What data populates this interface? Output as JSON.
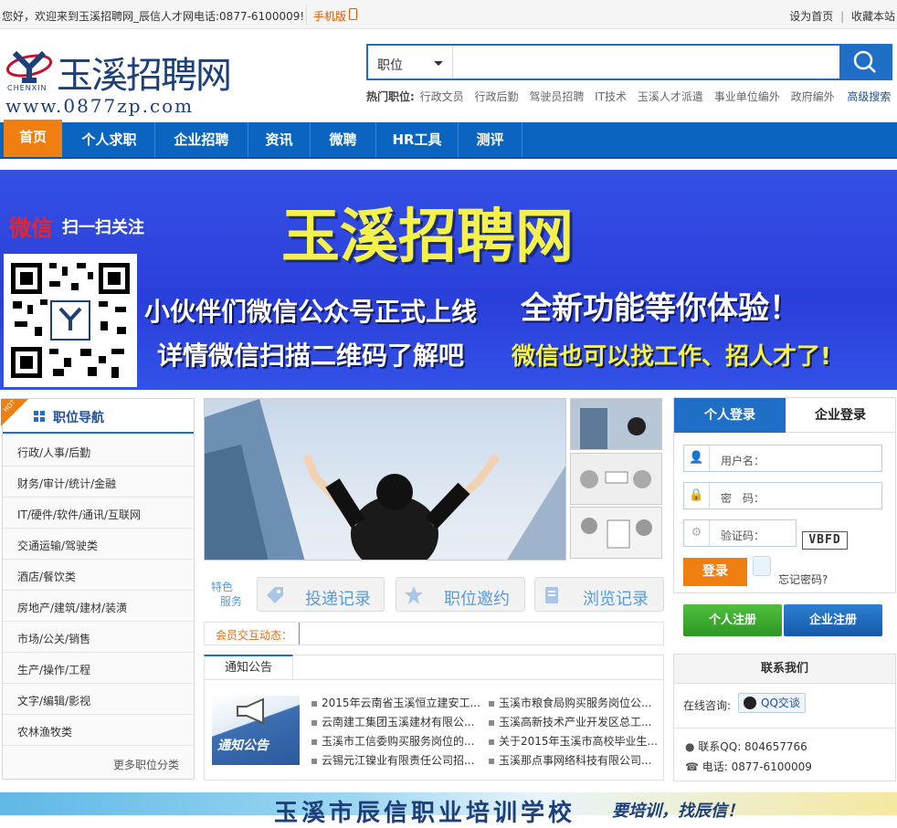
{
  "topbar": {
    "welcome": "您好，欢迎来到玉溪招聘网_辰信人才网电话:0877-6100009!",
    "mobile": "手机版",
    "set_home": "设为首页",
    "divider": "|",
    "bookmark": "收藏本站"
  },
  "logo": {
    "brand_cn": "玉溪招聘网",
    "brand_en": "CHENXIN",
    "url": "www.0877zp.com"
  },
  "search": {
    "type_selected": "职位",
    "query": "",
    "hot_label": "热门职位:",
    "hot_keywords": [
      "行政文员",
      "行政后勤",
      "驾驶员招聘",
      "IT技术",
      "玉溪人才派遣",
      "事业单位编外",
      "政府编外"
    ],
    "advanced": "高级搜索"
  },
  "nav": {
    "items": [
      "首页",
      "个人求职",
      "企业招聘",
      "资讯",
      "微聘",
      "HR工具",
      "测评"
    ]
  },
  "banner": {
    "wechat": "微信",
    "scan": "扫一扫关注",
    "title": "玉溪招聘网",
    "line1": "小伙伴们微信公众号正式上线",
    "line2": "详情微信扫描二维码了解吧",
    "line3": "全新功能等你体验！",
    "line4": "微信也可以找工作、招人才了!"
  },
  "jobnav": {
    "hot_badge": "HOT",
    "title": "职位导航",
    "items": [
      "行政/人事/后勤",
      "财务/审计/统计/金融",
      "IT/硬件/软件/通讯/互联网",
      "交通运输/驾驶类",
      "酒店/餐饮类",
      "房地产/建筑/建材/装潢",
      "市场/公关/销售",
      "生产/操作/工程",
      "文字/编辑/影视",
      "农林渔牧类"
    ],
    "more": "更多职位分类"
  },
  "feature": {
    "label_top": "特色",
    "label_bottom": "服务",
    "buttons": [
      "投递记录",
      "职位邀约",
      "浏览记录"
    ]
  },
  "ticker": {
    "label": "会员交互动态："
  },
  "notice": {
    "tab": "通知公告",
    "image_text": "通知公告",
    "left": [
      "2015年云南省玉溪恒立建安工...",
      "云南建工集团玉溪建材有限公...",
      "玉溪市工信委购买服务岗位的...",
      "云锡元江镍业有限责任公司招..."
    ],
    "right": [
      "玉溪市粮食局购买服务岗位公...",
      "玉溪高新技术产业开发区总工...",
      "关于2015年玉溪市高校毕业生...",
      "玉溪那点事网络科技有限公司..."
    ]
  },
  "login": {
    "tab_personal": "个人登录",
    "tab_company": "企业登录",
    "username_placeholder": "用户名：",
    "password_placeholder": "密　码：",
    "captcha_placeholder": "验证码：",
    "captcha_code": "VBFD",
    "login_button": "登录",
    "forgot": "忘记密码?"
  },
  "register": {
    "personal": "个人注册",
    "company": "企业注册"
  },
  "contact": {
    "title": "联系我们",
    "online_label": "在线咨询:",
    "qq_button": "QQ交谈",
    "qq_line": "联系QQ:  804657766",
    "phone_line": "电话:  0877-6100009"
  },
  "bottom_banner": {
    "text": "玉溪市辰信职业培训学校",
    "slogan": "要培训，找辰信！"
  },
  "colors": {
    "primary_blue": "#1f6fc7",
    "nav_blue": "#0b64c0",
    "orange": "#f07f11",
    "green": "#3aa52e",
    "banner_blue": "#2f47e0"
  }
}
